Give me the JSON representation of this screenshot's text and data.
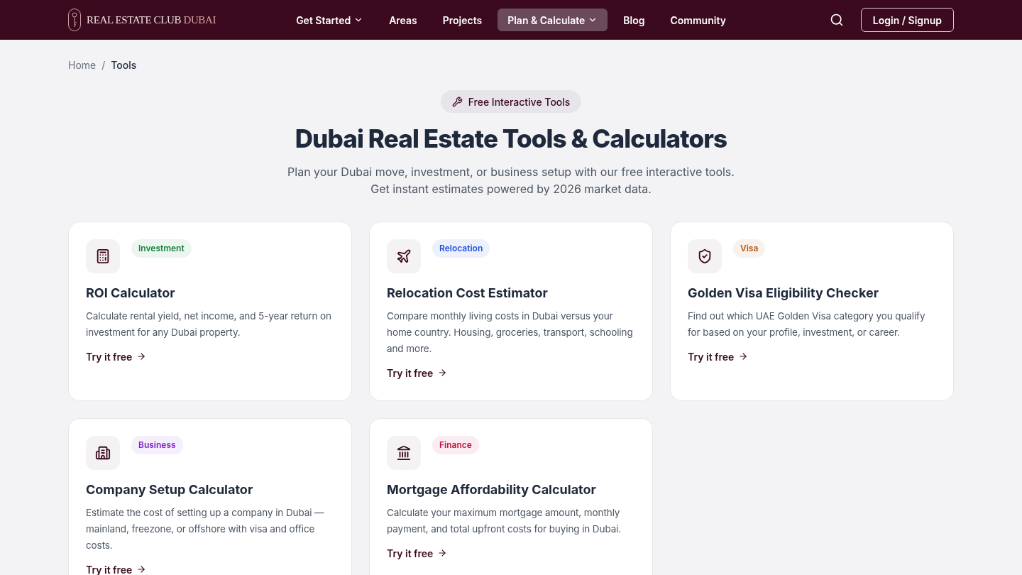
{
  "header": {
    "logo": {
      "main": "REAL ESTATE CLUB",
      "accent": "DUBAI"
    },
    "nav": [
      {
        "label": "Get Started",
        "has_menu": true,
        "selected": false
      },
      {
        "label": "Areas",
        "has_menu": false,
        "selected": false
      },
      {
        "label": "Projects",
        "has_menu": false,
        "selected": false
      },
      {
        "label": "Plan & Calculate",
        "has_menu": true,
        "selected": true
      },
      {
        "label": "Blog",
        "has_menu": false,
        "selected": false
      },
      {
        "label": "Community",
        "has_menu": false,
        "selected": false
      }
    ],
    "login": "Login / Signup"
  },
  "breadcrumb_separator": "/",
  "breadcrumbs": [
    {
      "label": "Home",
      "current": false
    },
    {
      "label": "Tools",
      "current": true
    }
  ],
  "hero": {
    "pill": "Free Interactive Tools",
    "title": "Dubai Real Estate Tools & Calculators",
    "subtitle": "Plan your Dubai move, investment, or business setup with our free interactive tools. Get instant estimates powered by 2026 market data."
  },
  "cards": [
    {
      "tag": "Investment",
      "color": "#15803d",
      "title": "ROI Calculator",
      "description": "Calculate rental yield, net income, and 5-year return on investment for any Dubai property.",
      "link": "Try it free"
    },
    {
      "tag": "Relocation",
      "color": "#1d4ed8",
      "title": "Relocation Cost Estimator",
      "description": "Compare monthly living costs in Dubai versus your home country. Housing, groceries, transport, schooling and more.",
      "link": "Try it free"
    },
    {
      "tag": "Visa",
      "color": "#b45309",
      "title": "Golden Visa Eligibility Checker",
      "description": "Find out which UAE Golden Visa category you qualify for based on your profile, investment, or career.",
      "link": "Try it free"
    },
    {
      "tag": "Business",
      "color": "#7e22ce",
      "title": "Company Setup Calculator",
      "description": "Estimate the cost of setting up a company in Dubai — mainland, freezone, or offshore with visa and office costs.",
      "link": "Try it free"
    },
    {
      "tag": "Finance",
      "color": "#be123c",
      "title": "Mortgage Affordability Calculator",
      "description": "Calculate your maximum mortgage amount, monthly payment, and total upfront costs for buying in Dubai.",
      "link": "Try it free"
    }
  ]
}
